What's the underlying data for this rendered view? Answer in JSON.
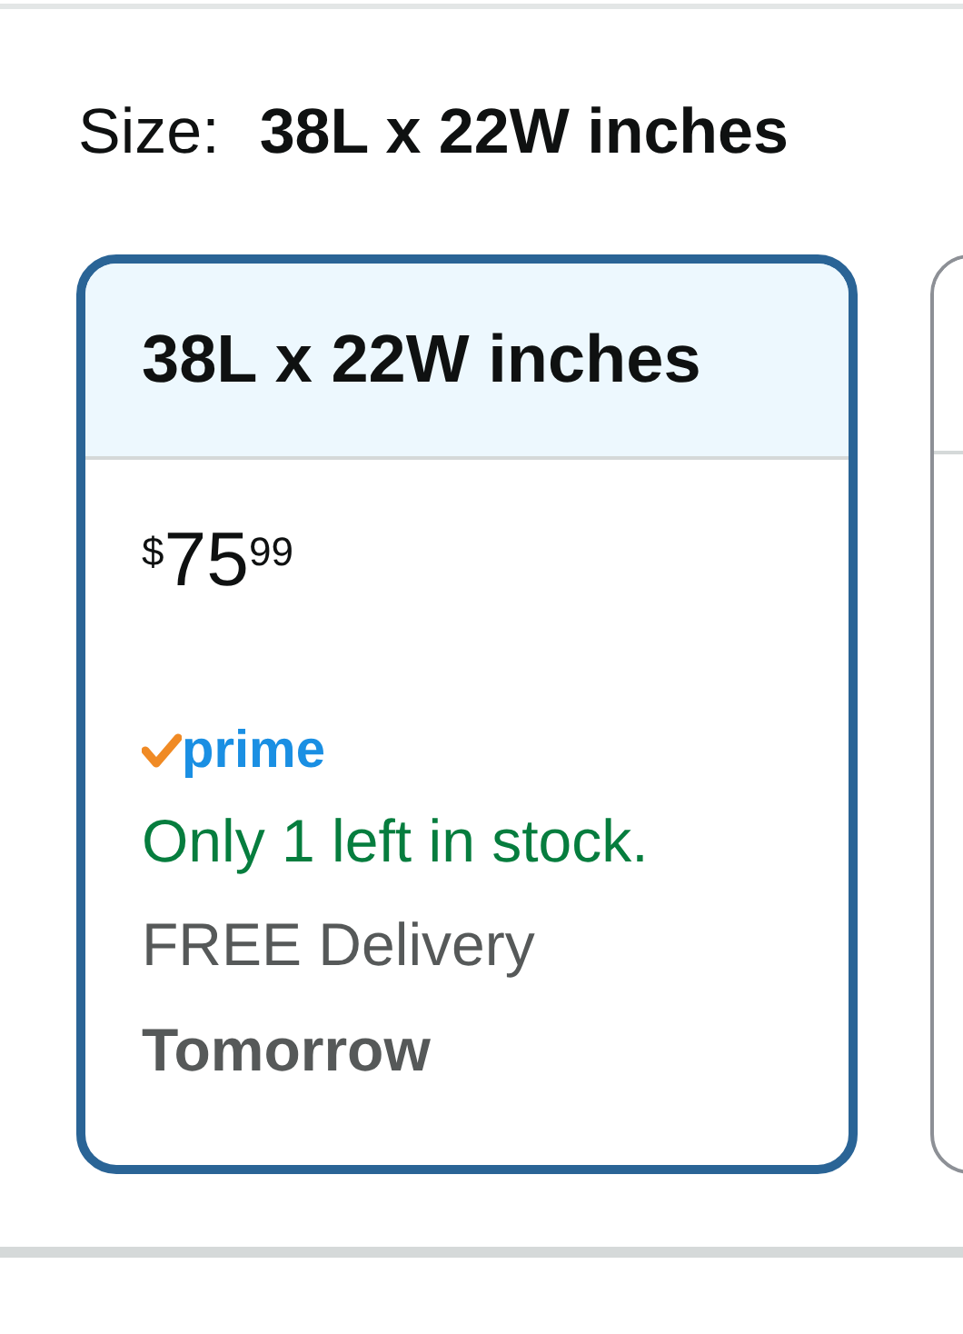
{
  "size_selector": {
    "label": "Size:",
    "value": "38L x 22W inches"
  },
  "options": [
    {
      "selected": true,
      "title": "38L x 22W inches",
      "price": {
        "symbol": "$",
        "whole": "75",
        "fraction": "99"
      },
      "badge": "prime",
      "stock": "Only 1 left in stock.",
      "delivery": "FREE Delivery",
      "delivery_date": "Tomorrow"
    },
    {
      "selected": false
    }
  ]
}
